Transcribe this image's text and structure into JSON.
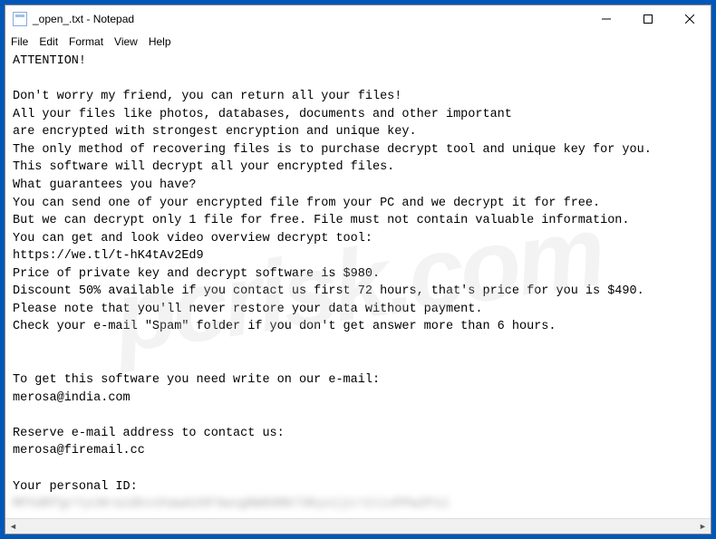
{
  "window": {
    "title": "_open_.txt - Notepad"
  },
  "menubar": {
    "file": "File",
    "edit": "Edit",
    "format": "Format",
    "view": "View",
    "help": "Help"
  },
  "content": {
    "line1": "ATTENTION!",
    "line2": "",
    "line3": "Don't worry my friend, you can return all your files!",
    "line4": "All your files like photos, databases, documents and other important",
    "line5": "are encrypted with strongest encryption and unique key.",
    "line6": "The only method of recovering files is to purchase decrypt tool and unique key for you.",
    "line7": "This software will decrypt all your encrypted files.",
    "line8": "What guarantees you have?",
    "line9": "You can send one of your encrypted file from your PC and we decrypt it for free.",
    "line10": "But we can decrypt only 1 file for free. File must not contain valuable information.",
    "line11": "You can get and look video overview decrypt tool:",
    "line12": "https://we.tl/t-hK4tAv2Ed9",
    "line13": "Price of private key and decrypt software is $980.",
    "line14": "Discount 50% available if you contact us first 72 hours, that's price for you is $490.",
    "line15": "Please note that you'll never restore your data without payment.",
    "line16": "Check your e-mail \"Spam\" folder if you don't get answer more than 6 hours.",
    "line17": "",
    "line18": "",
    "line19": "To get this software you need write on our e-mail:",
    "line20": "merosa@india.com",
    "line21": "",
    "line22": "Reserve e-mail address to contact us:",
    "line23": "merosa@firemail.cc",
    "line24": "",
    "line25": "Your personal ID:",
    "blurred_id": "MFhdRfgrYycNra1dkxshawA26F3wxg0W09RK73Kyx1jc=1tixPPw2P11"
  },
  "watermark": "pcrisk.com"
}
